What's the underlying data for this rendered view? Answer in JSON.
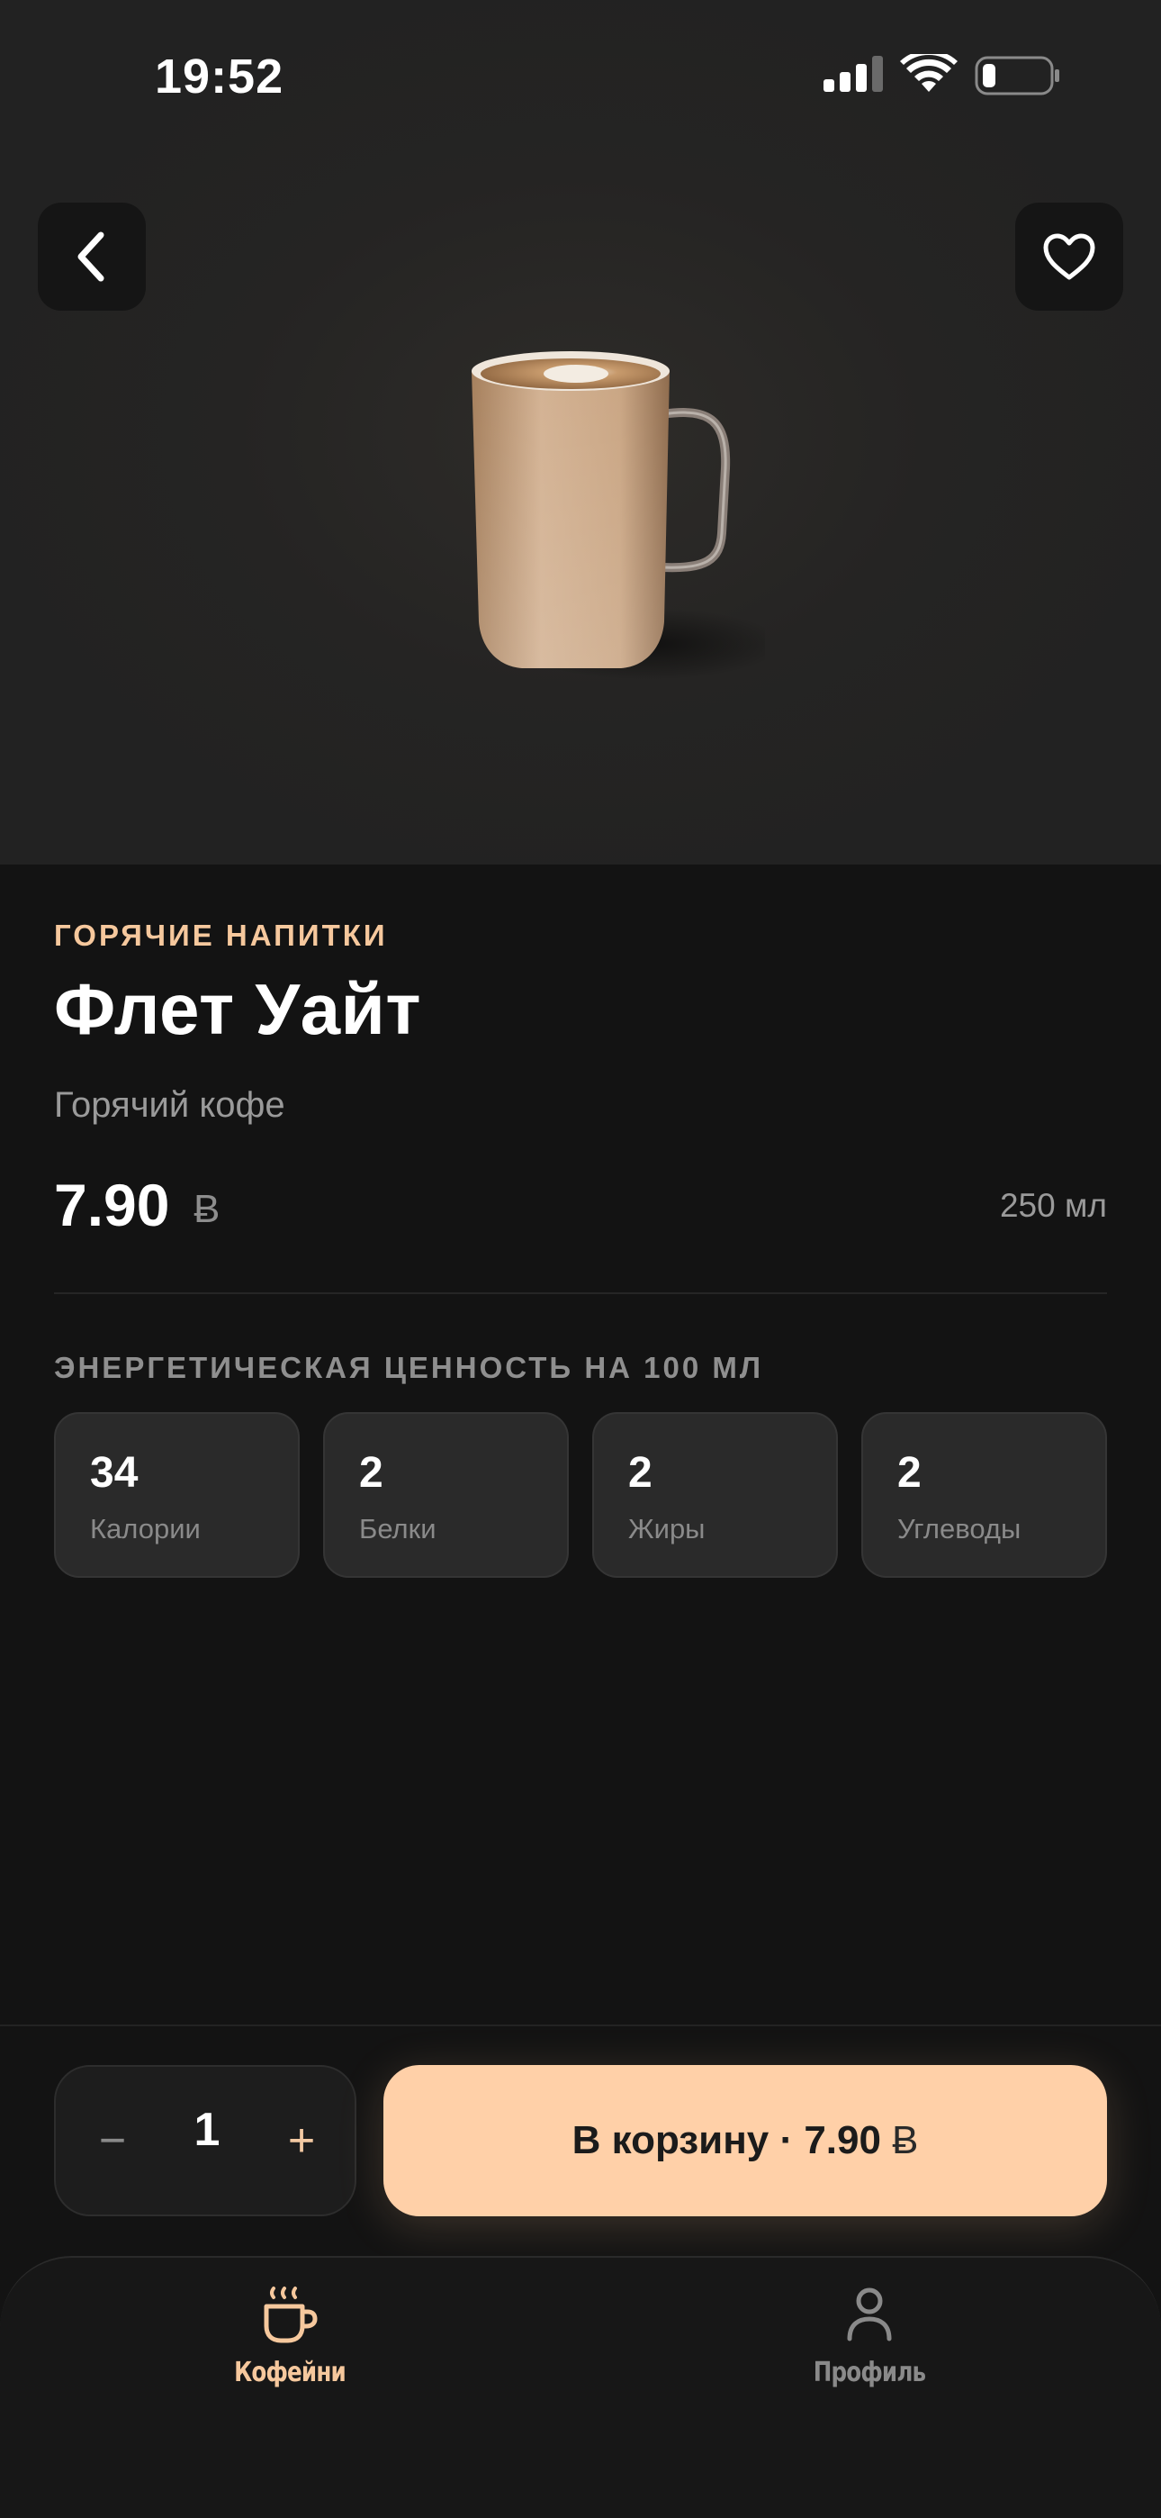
{
  "status_bar": {
    "time": "19:52",
    "icons": [
      "cellular-signal-icon",
      "wifi-icon",
      "battery-icon"
    ]
  },
  "header": {
    "back_icon": "chevron-left-icon",
    "favorite_icon": "heart-outline-icon"
  },
  "product": {
    "category": "ГОРЯЧИЕ НАПИТКИ",
    "name": "Флет Уайт",
    "description": "Горячий кофе",
    "price": "7.90",
    "currency": "Ƀ",
    "volume": "250 мл"
  },
  "nutrition": {
    "title": "ЭНЕРГЕТИЧЕСКАЯ ЦЕННОСТЬ НА 100 МЛ",
    "items": [
      {
        "value": "34",
        "label": "Калории"
      },
      {
        "value": "2",
        "label": "Белки"
      },
      {
        "value": "2",
        "label": "Жиры"
      },
      {
        "value": "2",
        "label": "Углеводы"
      }
    ]
  },
  "order": {
    "minus": "−",
    "quantity": "1",
    "plus": "+",
    "cart_label": "В корзину · 7.90",
    "cart_currency": "Ƀ"
  },
  "tabbar": {
    "tabs": [
      {
        "label": "Кофейни",
        "icon": "coffee-cup-icon",
        "active": true
      },
      {
        "label": "Профиль",
        "icon": "user-icon",
        "active": false
      }
    ]
  },
  "colors": {
    "accent": "#f6c89d",
    "cart_button": "#ffd0a8",
    "background": "#131313",
    "card": "#2a2a2a"
  }
}
